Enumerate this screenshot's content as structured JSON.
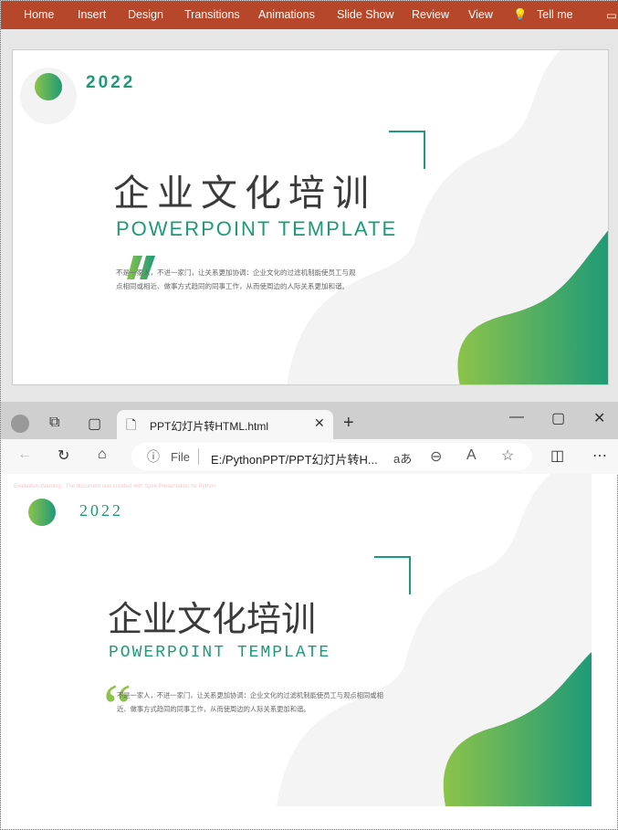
{
  "ribbon": {
    "tabs": [
      "Home",
      "Insert",
      "Design",
      "Transitions",
      "Animations",
      "Slide Show",
      "Review",
      "View",
      "Tell me"
    ]
  },
  "slide": {
    "year": "2022",
    "title": "企业文化培训",
    "subtitle": "POWERPOINT TEMPLATE",
    "body_line1": "不是一家人，不进一家门，让关系更加协调：企业文化的过滤机制能使员工与观",
    "body_line2": "点相同或相近、做事方式趋同的同事工作，从而使周边的人际关系更加和谐。",
    "body2_line1": "不是一家人，不进一家门，让关系更加协调：企业文化的过滤机制能使员工与观点相同或相",
    "body2_line2": "近、做事方式趋同的同事工作，从而使周边的人际关系更加和谐。",
    "colors": {
      "green": "#1e9a78",
      "lime": "#8cc34a"
    }
  },
  "browser": {
    "tab_title": "PPT幻灯片转HTML.html",
    "file_label": "File",
    "url": "E:/PythonPPT/PPT幻灯片转H...",
    "read_aloud": "aあ"
  },
  "warning": "Evaluation Warning : The document was created with  Spire.Presentation for Python"
}
